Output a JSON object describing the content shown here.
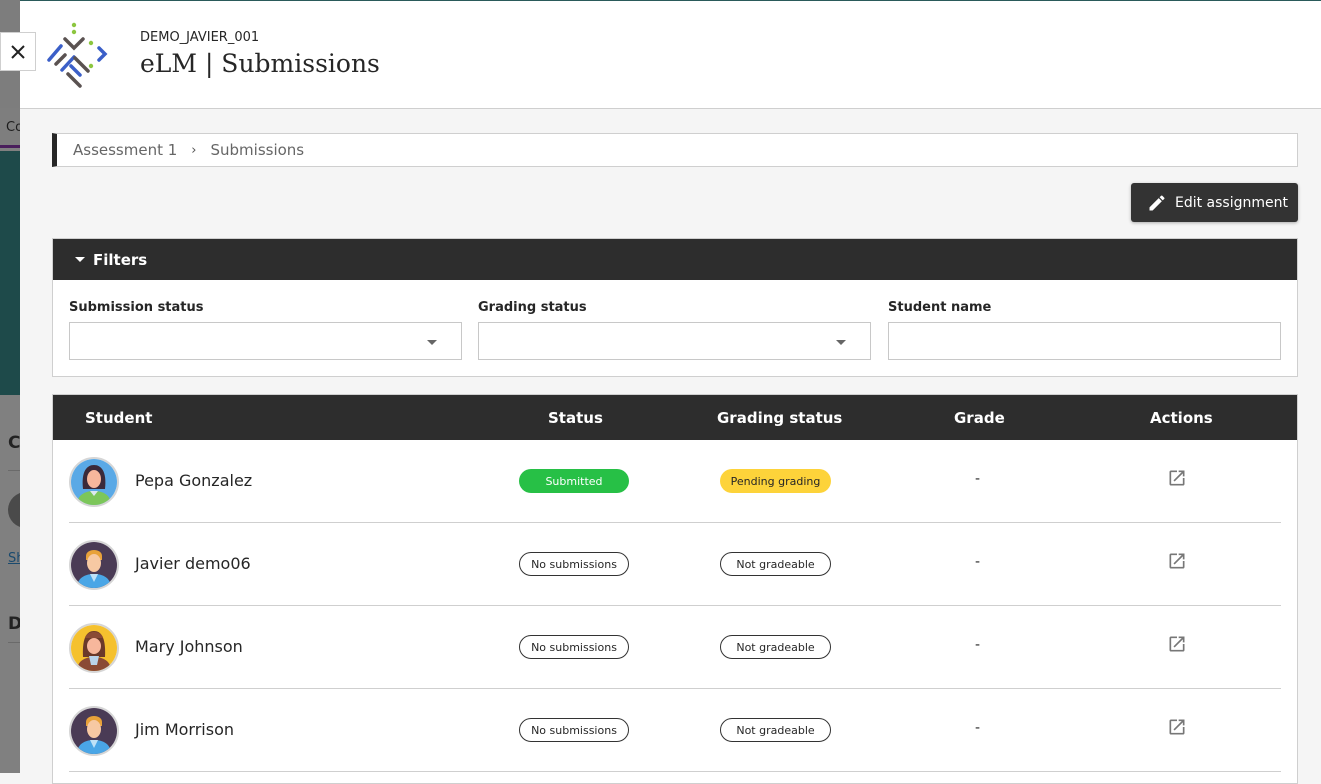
{
  "header": {
    "course_code": "DEMO_JAVIER_001",
    "title": "eLM | Submissions"
  },
  "background": {
    "nav_partial": "Co",
    "section_c": "C",
    "section_d": "D",
    "link_partial": "Sh"
  },
  "breadcrumb": {
    "items": [
      "Assessment 1",
      "Submissions"
    ]
  },
  "toolbar": {
    "edit_label": "Edit assignment"
  },
  "filters": {
    "title": "Filters",
    "submission_status": {
      "label": "Submission status",
      "value": ""
    },
    "grading_status": {
      "label": "Grading status",
      "value": ""
    },
    "student_name": {
      "label": "Student name",
      "value": "",
      "placeholder": ""
    }
  },
  "table": {
    "columns": [
      "Student",
      "Status",
      "Grading status",
      "Grade",
      "Actions"
    ],
    "rows": [
      {
        "name": "Pepa Gonzalez",
        "status": "Submitted",
        "grading": "Pending grading",
        "grade": "-"
      },
      {
        "name": "Javier demo06",
        "status": "No submissions",
        "grading": "Not gradeable",
        "grade": "-"
      },
      {
        "name": "Mary Johnson",
        "status": "No submissions",
        "grading": "Not gradeable",
        "grade": "-"
      },
      {
        "name": "Jim Morrison",
        "status": "No submissions",
        "grading": "Not gradeable",
        "grade": "-"
      }
    ]
  },
  "colors": {
    "header_dark": "#2d2d2d",
    "submitted": "#27c046",
    "pending": "#fdd33a",
    "logo_blue": "#3b5fc8",
    "logo_green": "#8cc63f",
    "logo_gray": "#5a5251"
  }
}
